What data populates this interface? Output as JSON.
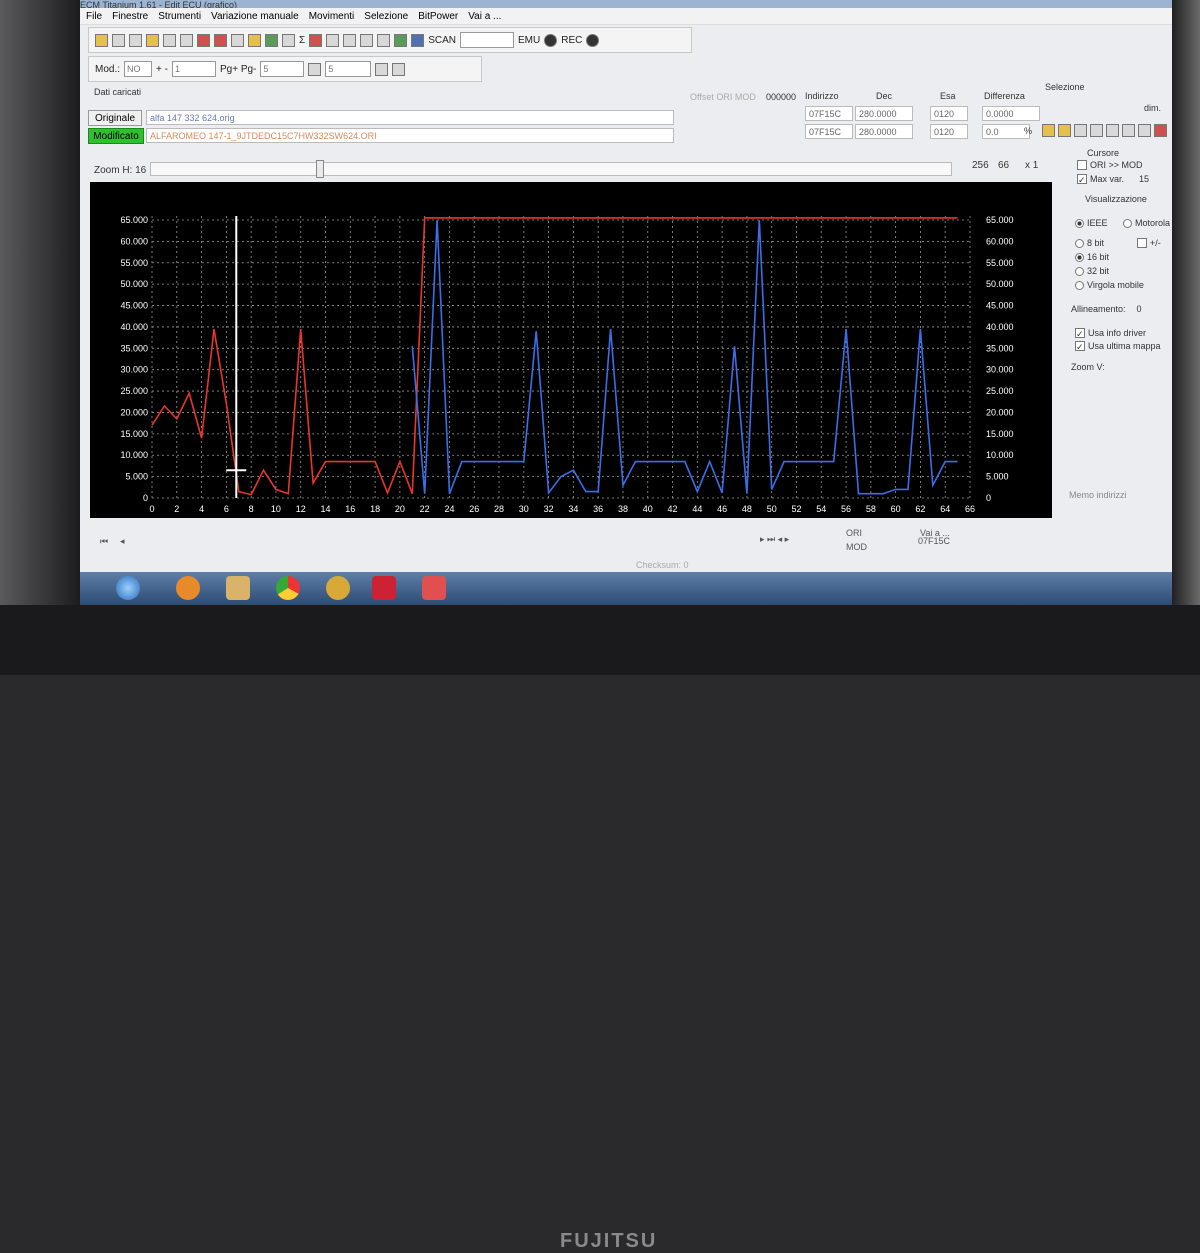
{
  "window": {
    "title": "ECM Titanium 1.61 - Edit ECU (grafico)"
  },
  "menu": [
    "File",
    "Finestre",
    "Strumenti",
    "Variazione manuale",
    "Movimenti",
    "Selezione",
    "BitPower",
    "Vai a ..."
  ],
  "toolbar": {
    "scan_label": "SCAN",
    "emu_label": "EMU",
    "rec_label": "REC"
  },
  "toolbar2": {
    "mod_label": "Mod.:",
    "mod_value": "NO",
    "pm_label": "+ -",
    "pm_value": "1",
    "pg_label": "Pg+ Pg-",
    "pg_value": "5",
    "field4": "5"
  },
  "info": {
    "dati_caricati": "Dati caricati",
    "offset_label": "Offset ORI MOD",
    "offset_value": "000000",
    "indirizzo_label": "Indirizzo",
    "dec_label": "Dec",
    "esa_label": "Esa",
    "differenza_label": "Differenza",
    "selezione_label": "Selezione",
    "dim_label": "dim.",
    "orig_btn": "Originale",
    "mod_btn": "Modificato",
    "orig_file": "alfa 147 332 624.orig",
    "mod_file": "ALFAROMEO 147-1_9JTDEDC15C7HW332SW624.ORI",
    "row1_addr": "07F15C",
    "row1_dec": "280.0000",
    "row1_esa": "0120",
    "row1_diff": "0.0000",
    "row2_addr": "07F15C",
    "row2_dec": "280.0000",
    "row2_esa": "0120",
    "row2_diff": "0.0",
    "row2_unit": "%"
  },
  "zoom": {
    "label": "Zoom H:",
    "value": "16",
    "v1": "256",
    "v2": "66",
    "v3": "x 1"
  },
  "side": {
    "cursore": "Cursore",
    "ori_mod": "ORI >> MOD",
    "max_var": "Max var.",
    "max_var_value": "15",
    "visualizzazione": "Visualizzazione",
    "ieee": "IEEE",
    "motorola": "Motorola",
    "b8": "8 bit",
    "b16": "16 bit",
    "b32": "32 bit",
    "pm": "+/-",
    "virgola": "Virgola mobile",
    "allineamento": "Allineamento:",
    "allineamento_value": "0",
    "usa_info": "Usa info driver",
    "usa_mappa": "Usa ultima mappa",
    "zoom_v": "Zoom V:",
    "memo": "Memo indirizzi"
  },
  "bottom": {
    "ori": "ORI",
    "mod": "MOD",
    "vai_a": "Vai a ...",
    "vai_addr": "07F15C",
    "checksum": "Checksum: 0"
  },
  "chart_data": {
    "type": "line",
    "x": [
      0,
      1,
      2,
      3,
      4,
      5,
      6,
      7,
      8,
      9,
      10,
      11,
      12,
      13,
      14,
      15,
      16,
      17,
      18,
      19,
      20,
      21,
      22,
      23,
      24,
      25,
      26,
      27,
      28,
      29,
      30,
      31,
      32,
      33,
      34,
      35,
      36,
      37,
      38,
      39,
      40,
      41,
      42,
      43,
      44,
      45,
      46,
      47,
      48,
      49,
      50,
      51,
      52,
      53,
      54,
      55,
      56,
      57,
      58,
      59,
      60,
      61,
      62,
      63,
      64,
      65
    ],
    "series": [
      {
        "color": "#e8372a",
        "values": [
          17000,
          21500,
          18500,
          24500,
          14000,
          39500,
          22000,
          1500,
          800,
          6500,
          2000,
          1000,
          39500,
          3500,
          8500,
          8500,
          8500,
          8500,
          8500,
          1200,
          8500,
          1000,
          65500,
          65500,
          65500,
          65500,
          65500,
          65500,
          65500,
          65500,
          65500,
          65500,
          65500,
          65500,
          65500,
          65500,
          65500,
          65500,
          65500,
          65500,
          65500,
          65500,
          65500,
          65500,
          65500,
          65500,
          65500,
          65500,
          65500,
          65500,
          65500,
          65500,
          65500,
          65500,
          65500,
          65500,
          65500,
          65500,
          65500,
          65500,
          65500,
          65500,
          65500,
          65500,
          65500,
          65500
        ]
      },
      {
        "color": "#3a6fe8",
        "values": [
          null,
          null,
          null,
          null,
          null,
          null,
          null,
          null,
          null,
          null,
          null,
          null,
          null,
          null,
          null,
          null,
          null,
          null,
          null,
          null,
          null,
          35500,
          1000,
          65000,
          1000,
          8500,
          8500,
          8500,
          8500,
          8500,
          8500,
          39000,
          1200,
          5000,
          6500,
          1500,
          1500,
          39500,
          3000,
          8500,
          8500,
          8500,
          8500,
          8500,
          1500,
          8500,
          1200,
          35500,
          1000,
          65000,
          2000,
          8500,
          8500,
          8500,
          8500,
          8500,
          39500,
          1000,
          1000,
          1000,
          2000,
          2000,
          39500,
          3000,
          8500,
          8500
        ]
      }
    ],
    "x_ticks": [
      0,
      2,
      4,
      6,
      8,
      10,
      12,
      14,
      16,
      18,
      20,
      22,
      24,
      26,
      28,
      30,
      32,
      34,
      36,
      38,
      40,
      42,
      44,
      46,
      48,
      50,
      52,
      54,
      56,
      58,
      60,
      62,
      64,
      66
    ],
    "y_left_ticks": [
      "0",
      "5.000",
      "10.000",
      "15.000",
      "20.000",
      "25.000",
      "30.000",
      "35.000",
      "40.000",
      "45.000",
      "50.000",
      "55.000",
      "60.000",
      "65.000"
    ],
    "y_right_ticks": [
      "0",
      "5.000",
      "10.000",
      "15.000",
      "20.000",
      "25.000",
      "30.000",
      "35.000",
      "40.000",
      "45.000",
      "50.000",
      "55.000",
      "60.000",
      "65.000"
    ],
    "xlim": [
      0,
      66
    ],
    "ylim": [
      0,
      65000
    ],
    "cursor_x": 6.8,
    "grid": true
  }
}
